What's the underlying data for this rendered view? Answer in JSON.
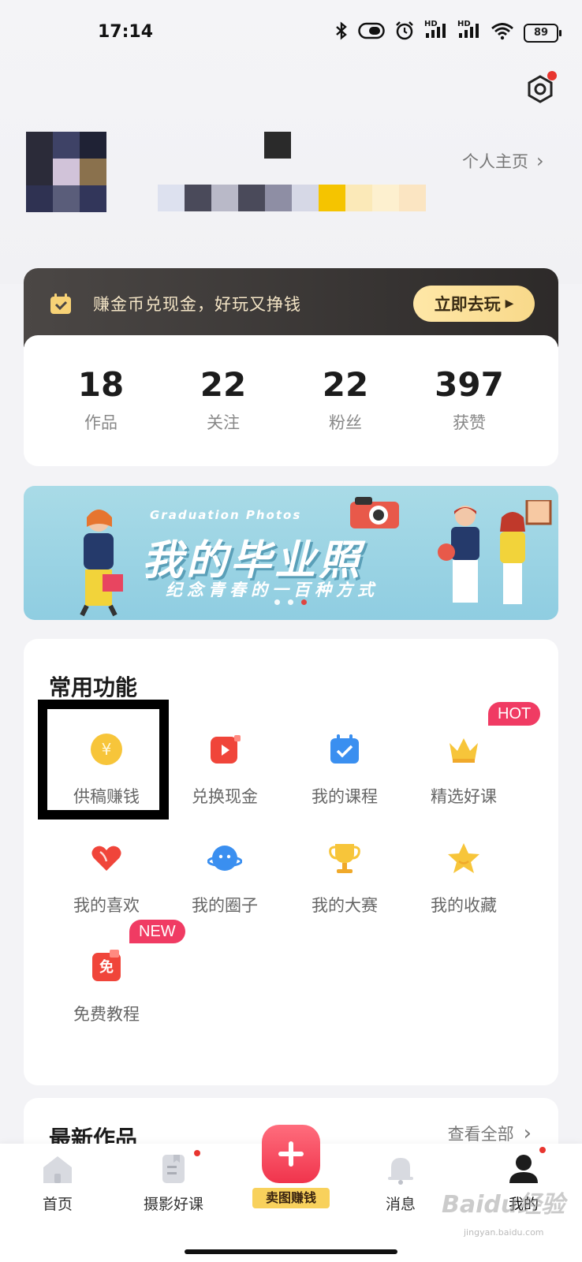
{
  "status_bar": {
    "time": "17:14",
    "signal_label_1": "HD",
    "signal_label_2": "HD",
    "battery": "89"
  },
  "profile": {
    "homepage_link": "个人主页",
    "mosaic_colors": [
      "#2b2b39",
      "#3e4266",
      "#1f2235",
      "#2b2b39",
      "#d1c3d9",
      "#8a714d",
      "#2f3252",
      "#5a5d7a",
      "#32365a"
    ],
    "name_mosaic_colors": [
      "#2a2a2a"
    ],
    "id_mosaic_colors": [
      "#dde1ef",
      "#4a4a5a",
      "#b9b9c8",
      "#4a4a5a",
      "#8e8ea4",
      "#d6d8e6",
      "#f5c400",
      "#fbe9b8",
      "#fdf0cf",
      "#fbe5c2"
    ]
  },
  "gold_banner": {
    "text": "赚金币兑现金，好玩又挣钱",
    "button": "立即去玩",
    "colors": {
      "bg_start": "#4b4745",
      "bg_end": "#2d2a29",
      "button": "#f8d98a",
      "text": "#f4e5c6"
    }
  },
  "stats": [
    {
      "value": "18",
      "label": "作品"
    },
    {
      "value": "22",
      "label": "关注"
    },
    {
      "value": "22",
      "label": "粉丝"
    },
    {
      "value": "397",
      "label": "获赞"
    }
  ],
  "promo": {
    "subtitle": "Graduation Photos",
    "title": "我的毕业照",
    "caption": "纪念青春的一百种方式",
    "slide_count": 3,
    "active_slide": 3
  },
  "features": {
    "title": "常用功能",
    "items": [
      {
        "label": "供稿赚钱",
        "icon": "yuan-coin-icon",
        "color": "#f7c53a"
      },
      {
        "label": "兑换现金",
        "icon": "video-play-icon",
        "color": "#f0453a"
      },
      {
        "label": "我的课程",
        "icon": "calendar-check-icon",
        "color": "#3a8ff0"
      },
      {
        "label": "精选好课",
        "icon": "crown-icon",
        "color": "#f7c53a",
        "badge": "HOT"
      },
      {
        "label": "我的喜欢",
        "icon": "heart-icon",
        "color": "#f0453a"
      },
      {
        "label": "我的圈子",
        "icon": "planet-icon",
        "color": "#3a8ff0"
      },
      {
        "label": "我的大赛",
        "icon": "trophy-icon",
        "color": "#f7c53a"
      },
      {
        "label": "我的收藏",
        "icon": "star-icon",
        "color": "#f7c53a"
      },
      {
        "label": "免费教程",
        "icon": "free-tag-icon",
        "color": "#f0453a",
        "badge": "NEW",
        "icon_text": "免"
      }
    ]
  },
  "latest": {
    "title": "最新作品",
    "more": "查看全部"
  },
  "bottom_nav": {
    "items": [
      {
        "label": "首页",
        "icon": "home-icon"
      },
      {
        "label": "摄影好课",
        "icon": "book-icon",
        "dot": true
      },
      {
        "label": "卖图赚钱",
        "icon": "plus-icon"
      },
      {
        "label": "消息",
        "icon": "bell-icon"
      },
      {
        "label": "我的",
        "icon": "user-icon",
        "dot": true
      }
    ]
  },
  "watermark": {
    "text": "Baidu经验",
    "sub": "jingyan.baidu.com"
  }
}
